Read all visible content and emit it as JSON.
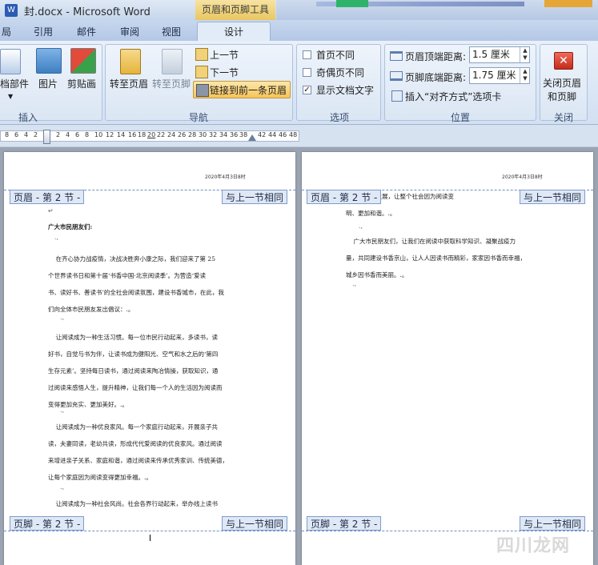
{
  "window": {
    "title": "封.docx - Microsoft Word",
    "context_tool": "页眉和页脚工具"
  },
  "tabs": [
    "局",
    "引用",
    "邮件",
    "审阅",
    "视图"
  ],
  "active_tab": "设计",
  "ribbon": {
    "insert": {
      "group": "插入",
      "buttons": [
        "档部件",
        "图片",
        "剪贴画"
      ]
    },
    "nav": {
      "group": "导航",
      "goto_header": "转至页眉",
      "goto_footer": "转至页脚",
      "prev": "上一节",
      "next": "下一节",
      "link_prev": "链接到前一条页眉"
    },
    "options": {
      "group": "选项",
      "items": [
        {
          "label": "首页不同",
          "checked": false
        },
        {
          "label": "奇偶页不同",
          "checked": false
        },
        {
          "label": "显示文档文字",
          "checked": true
        }
      ]
    },
    "position": {
      "group": "位置",
      "header_dist_label": "页眉顶端距离:",
      "header_dist": "1.5 厘米",
      "footer_dist_label": "页脚底端距离:",
      "footer_dist": "1.75 厘米",
      "insert_tab": "插入“对齐方式”选项卡"
    },
    "close": {
      "group": "关闭",
      "label1": "关闭页眉",
      "label2": "和页脚"
    }
  },
  "ruler": {
    "ticks": [
      "8",
      "6",
      "4",
      "2",
      "2",
      "4",
      "6",
      "8",
      "10",
      "12",
      "14",
      "16",
      "18",
      "20",
      "22",
      "24",
      "26",
      "28",
      "30",
      "32",
      "34",
      "36",
      "38",
      "42",
      "44",
      "46",
      "48"
    ]
  },
  "page_left": {
    "date": "2020年4月3日8时",
    "header_tab": "页眉 - 第 2 节 -",
    "same_as_prev": "与上一节相同",
    "footer_tab": "页脚 - 第 2 节 -",
    "footer_same": "与上一节相同",
    "return_mark": "↵",
    "greeting": "广大市民朋友们:",
    "paragraphs": [
      "    在齐心协力战疫情，决战决胜奔小康之际，我们迎来了第 25\n个世界读书日和第十届‘书香中国·北京阅读季’。为营造‘爱读\n书、读好书、善读书’的全社会阅读氛围，建设书香城市，在此，我\n们向全体市民朋友发出倡议：.。",
      "    让阅读成为一种生活习惯。每一位市民行动起来，多读书，读\n好书，自觉与书为伴，让读书成为健阳光、空气和水之后的‘第四\n生存元素’。坚持每日读书，通过阅读来陶冶情操，获取知识，通\n过阅读来感悟人生，提升精神，让我们每一个人的生活因为阅读而\n变得更加充实、更加美好。.。",
      "    让阅读成为一种优良家风。每一个家庭行动起来，开展亲子共\n读，夫妻同读，老幼共读，形成代代爱阅读的优良家风。通过阅读\n来增进亲子关系、家庭和谐，通过阅读来传承优秀家训、传统美德，\n让每个家庭因为阅读变得更加幸福。.。",
      "    让阅读成为一种社会风尚。社会各界行动起来，举办线上读书\n分享会、读书故事会，通过阅读来凝聚共识，促进……"
    ]
  },
  "page_right": {
    "date": "2020年4月3日8时",
    "header_tab": "页眉 - 第 2 节 -",
    "same_as_prev": "与上一节相同",
    "footer_tab": "页脚 - 第 2 节 -",
    "footer_same": "与上一节相同",
    "paragraphs": [
      "名度、推动发展，让整个社会因为阅读变\n明、更加和谐。.。",
      "    广大市民朋友们，让我们在阅读中获取科学知识、凝聚战疫力\n量，共同建设书香京山，让人人因读书而精彩，家家因书香而幸福，\n城乡因书香而美丽。.。"
    ]
  },
  "watermark": "四川龙网"
}
